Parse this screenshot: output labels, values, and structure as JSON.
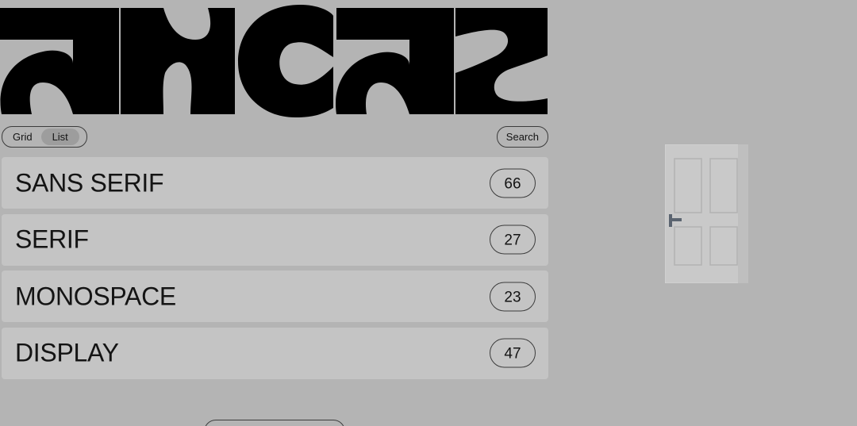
{
  "brand": {
    "logo_alt": "uncut",
    "logo_color": "#000000"
  },
  "toolbar": {
    "view_options": [
      "Grid",
      "List"
    ],
    "active_view": "List",
    "search_label": "Search"
  },
  "categories": [
    {
      "label": "SANS SERIF",
      "count": "66"
    },
    {
      "label": "SERIF",
      "count": "27"
    },
    {
      "label": "MONOSPACE",
      "count": "23"
    },
    {
      "label": "DISPLAY",
      "count": "47"
    }
  ],
  "decor": {
    "door_icon": "door-icon"
  },
  "colors": {
    "background": "#b4b4b4",
    "row_background": "#c4c4c4",
    "active_toggle": "#9d9d9d",
    "text": "#141414"
  }
}
